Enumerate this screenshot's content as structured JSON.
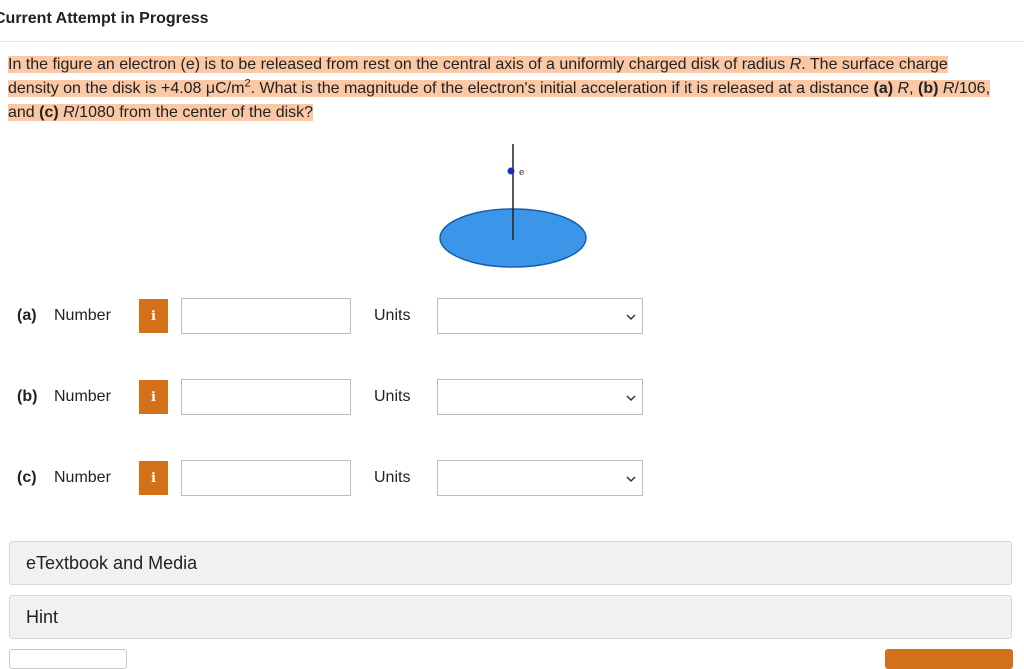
{
  "header": {
    "title": "Current Attempt in Progress"
  },
  "question": {
    "p1": "In the figure an electron (e) is to be released from rest on the central axis of a uniformly charged disk of radius ",
    "var_R1": "R",
    "p2": ". The surface charge density on the disk is +4.08 μC/m",
    "sup2": "2",
    "p3": ". What is the magnitude of the electron's initial acceleration if it is released at a distance ",
    "a": "(a)",
    "p4": " ",
    "var_R2": "R",
    "p5": ", ",
    "b": "(b)",
    "p6": " ",
    "var_R3": "R",
    "p7": "/106, and ",
    "c": "(c)",
    "p8": " ",
    "var_R4": "R",
    "p9": "/1080 from the center of the disk?"
  },
  "figure": {
    "electron_label": "e",
    "colors": {
      "disk": "#3b96ea",
      "disk_outline": "#1b5fa8",
      "electron": "#1d2db8",
      "axis": "#222222"
    }
  },
  "rows": [
    {
      "part": "(a)",
      "number_label": "Number",
      "info_icon": "i",
      "value": "",
      "units_label": "Units",
      "units_value": ""
    },
    {
      "part": "(b)",
      "number_label": "Number",
      "info_icon": "i",
      "value": "",
      "units_label": "Units",
      "units_value": ""
    },
    {
      "part": "(c)",
      "number_label": "Number",
      "info_icon": "i",
      "value": "",
      "units_label": "Units",
      "units_value": ""
    }
  ],
  "panels": {
    "etextbook": "eTextbook and Media",
    "hint": "Hint"
  },
  "colors": {
    "accent": "#d2711a",
    "highlight": "#fbc8a6"
  }
}
